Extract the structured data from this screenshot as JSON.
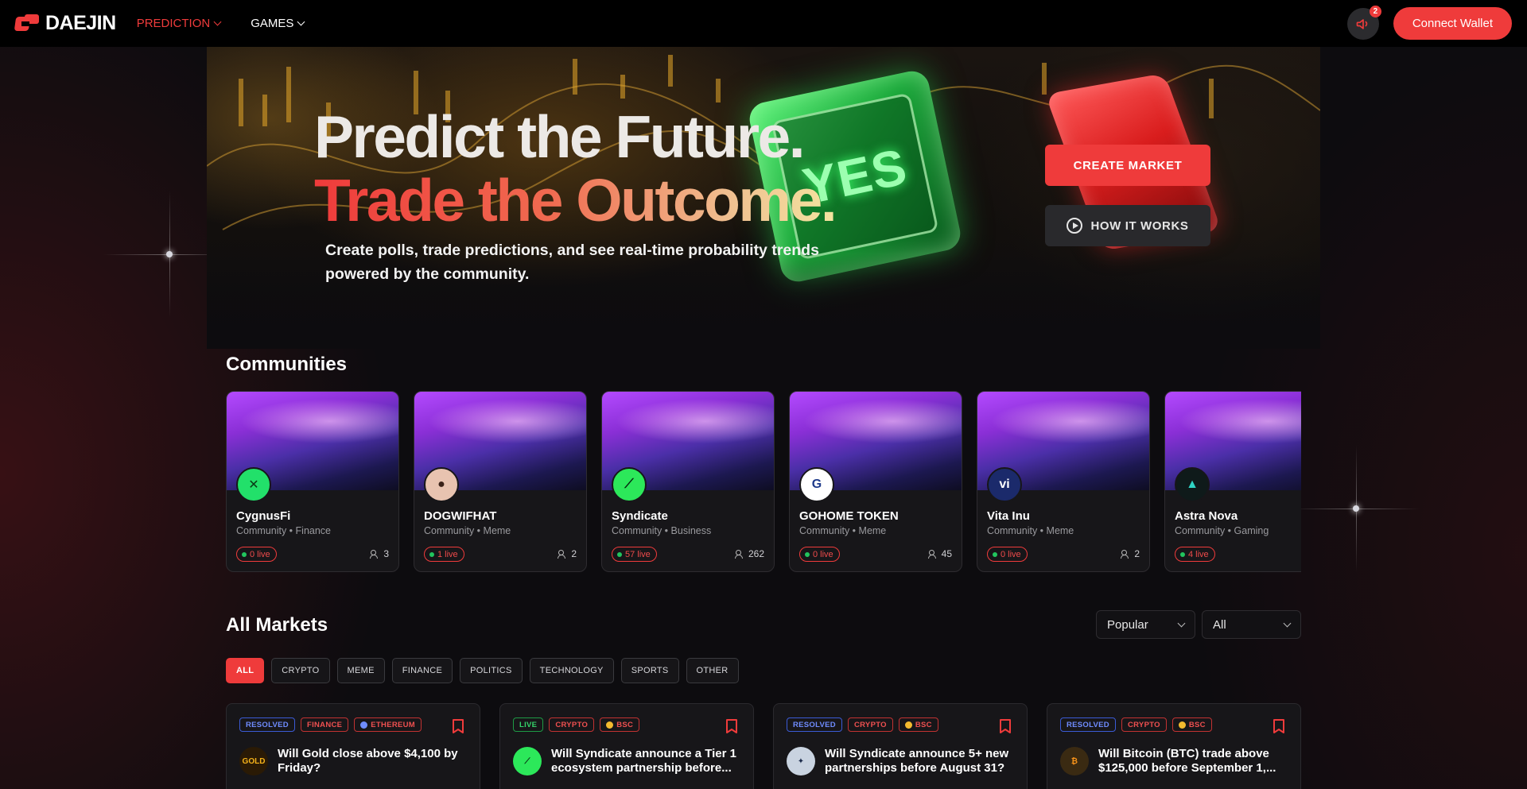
{
  "brand": {
    "name": "DAEJIN",
    "accent": "#ef3b3b"
  },
  "nav": {
    "items": [
      {
        "label": "PREDICTION",
        "active": true
      },
      {
        "label": "GAMES",
        "active": false
      }
    ],
    "notification_count": "2",
    "connect_label": "Connect Wallet"
  },
  "hero": {
    "line1": "Predict the Future.",
    "line2": "Trade the Outcome.",
    "subtitle": "Create polls, trade predictions, and see real-time probability trends powered by the community.",
    "cube_text": "YES",
    "create_label": "CREATE MARKET",
    "how_label": "HOW IT WORKS"
  },
  "communities": {
    "title": "Communities",
    "items": [
      {
        "name": "CygnusFi",
        "meta": "Community • Finance",
        "live": "0 live",
        "members": "3",
        "avatar_bg": "#22e06a",
        "avatar_fg": "#0a3a16",
        "avatar_glyph": "✕"
      },
      {
        "name": "DOGWIFHAT",
        "meta": "Community • Meme",
        "live": "1 live",
        "members": "2",
        "avatar_bg": "#e8c3b0",
        "avatar_fg": "#3a2218",
        "avatar_glyph": "●"
      },
      {
        "name": "Syndicate",
        "meta": "Community • Business",
        "live": "57 live",
        "members": "262",
        "avatar_bg": "#2ce85a",
        "avatar_fg": "#062a10",
        "avatar_glyph": "⟋"
      },
      {
        "name": "GOHOME TOKEN",
        "meta": "Community • Meme",
        "live": "0 live",
        "members": "45",
        "avatar_bg": "#ffffff",
        "avatar_fg": "#1e3a8a",
        "avatar_glyph": "G"
      },
      {
        "name": "Vita Inu",
        "meta": "Community • Meme",
        "live": "0 live",
        "members": "2",
        "avatar_bg": "#1b2a6b",
        "avatar_fg": "#ffffff",
        "avatar_glyph": "vi"
      },
      {
        "name": "Astra Nova",
        "meta": "Community • Gaming",
        "live": "4 live",
        "members": "",
        "avatar_bg": "#0f1a1a",
        "avatar_fg": "#2fd4c4",
        "avatar_glyph": "▲"
      }
    ]
  },
  "markets": {
    "title": "All Markets",
    "sort_value": "Popular",
    "filter_value": "All",
    "categories": [
      "ALL",
      "CRYPTO",
      "MEME",
      "FINANCE",
      "POLITICS",
      "TECHNOLOGY",
      "SPORTS",
      "OTHER"
    ],
    "active_category": "ALL",
    "cards": [
      {
        "status": "RESOLVED",
        "category": "FINANCE",
        "chain": "ETHEREUM",
        "chain_color": "#6f8cff",
        "question": "Will Gold close above $4,100 by Friday?",
        "avatar_bg": "#2a1a05",
        "avatar_fg": "#f5b21a",
        "avatar_glyph": "GOLD"
      },
      {
        "status": "LIVE",
        "category": "CRYPTO",
        "chain": "BSC",
        "chain_color": "#f3ba2f",
        "question": "Will Syndicate announce a Tier 1 ecosystem partnership before...",
        "avatar_bg": "#2ce85a",
        "avatar_fg": "#062a10",
        "avatar_glyph": "⟋"
      },
      {
        "status": "RESOLVED",
        "category": "CRYPTO",
        "chain": "BSC",
        "chain_color": "#f3ba2f",
        "question": "Will Syndicate announce 5+ new partnerships before August 31?",
        "avatar_bg": "#c9d3e0",
        "avatar_fg": "#1b2a4a",
        "avatar_glyph": "✦"
      },
      {
        "status": "RESOLVED",
        "category": "CRYPTO",
        "chain": "BSC",
        "chain_color": "#f3ba2f",
        "question": "Will Bitcoin (BTC) trade above $125,000 before September 1,...",
        "avatar_bg": "#3a2a12",
        "avatar_fg": "#f7931a",
        "avatar_glyph": "₿"
      }
    ]
  }
}
